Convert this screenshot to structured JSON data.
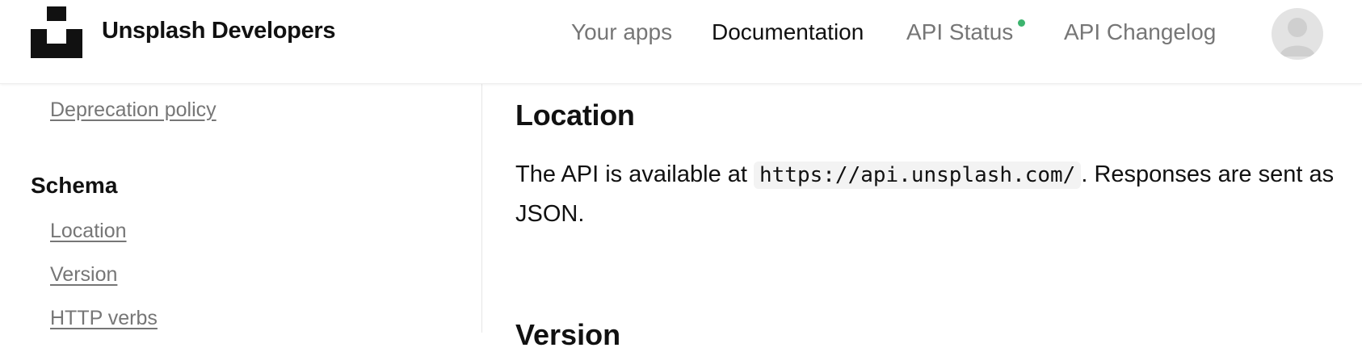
{
  "header": {
    "brand": "Unsplash Developers",
    "nav": {
      "your_apps": "Your apps",
      "documentation": "Documentation",
      "api_status": "API Status",
      "api_changelog": "API Changelog"
    },
    "status_color": "#3cb46e"
  },
  "sidebar": {
    "deprecation": "Deprecation policy",
    "section_title": "Schema",
    "items": [
      "Location",
      "Version",
      "HTTP verbs"
    ]
  },
  "main": {
    "heading": "Location",
    "text_before": "The API is available at ",
    "code": "https://api.unsplash.com/",
    "text_after": ". Responses are sent as JSON.",
    "next_heading": "Version"
  }
}
